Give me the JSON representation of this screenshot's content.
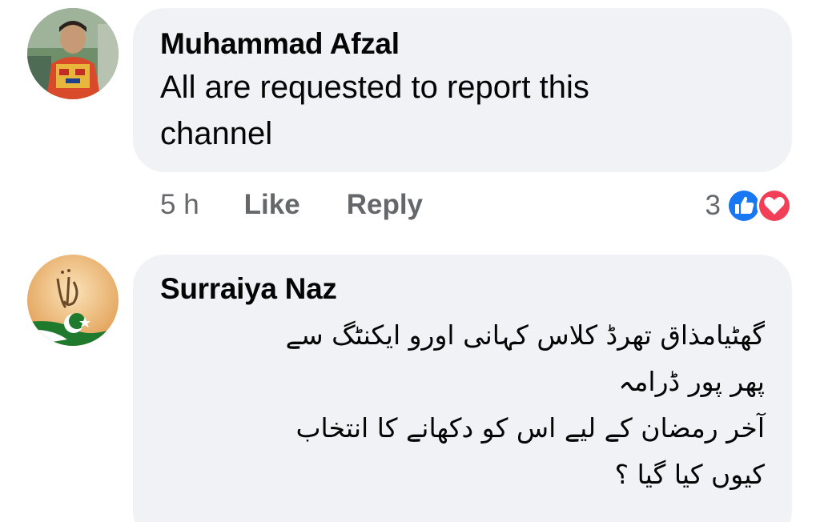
{
  "comments": [
    {
      "author": "Muhammad Afzal",
      "text": "All are requested to report this channel",
      "time": "5 h",
      "like_label": "Like",
      "reply_label": "Reply",
      "reaction_count": "3",
      "reactions": [
        "like-icon",
        "love-icon"
      ]
    },
    {
      "author": "Surraiya Naz",
      "text_lines": [
        "گھٹیامذاق تھرڈ کلاس کہانی اورو ایکنٹگ سے",
        "پھر پور ڈرامہ",
        "آخر رمضان کے لیے اس کو دکھانے کا انتخاب",
        "کیوں کیا گیا ؟"
      ]
    }
  ],
  "colors": {
    "bubble_bg": "#f0f2f5",
    "secondary_text": "#65676b",
    "like_blue": "#1877f2",
    "love_red": "#f33e58"
  }
}
